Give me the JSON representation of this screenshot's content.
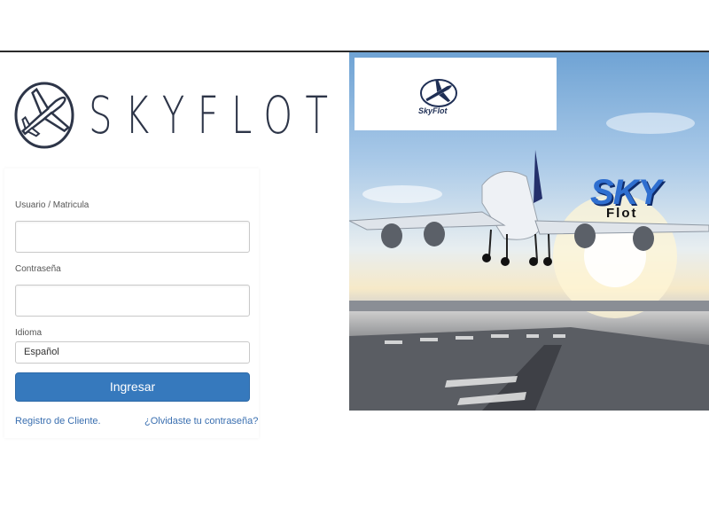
{
  "brand": {
    "logo_text": "SKYFLOT"
  },
  "form": {
    "username_label": "Usuario / Matricula",
    "username_value": "",
    "password_label": "Contraseña",
    "password_value": "",
    "language_label": "Idioma",
    "language_selected": "Español",
    "submit_label": "Ingresar",
    "register_link": "Registro de Cliente.",
    "forgot_link": "¿Olvidaste tu contraseña?"
  },
  "hero": {
    "card_caption": "SkyFlot",
    "sky_word": "SKY",
    "flot_word": "Flot"
  },
  "colors": {
    "primary_button": "#3679bd",
    "link": "#3a6fb0",
    "logo": "#2d3548"
  },
  "icons": {
    "logo_mark": "airplane-circle-icon"
  }
}
